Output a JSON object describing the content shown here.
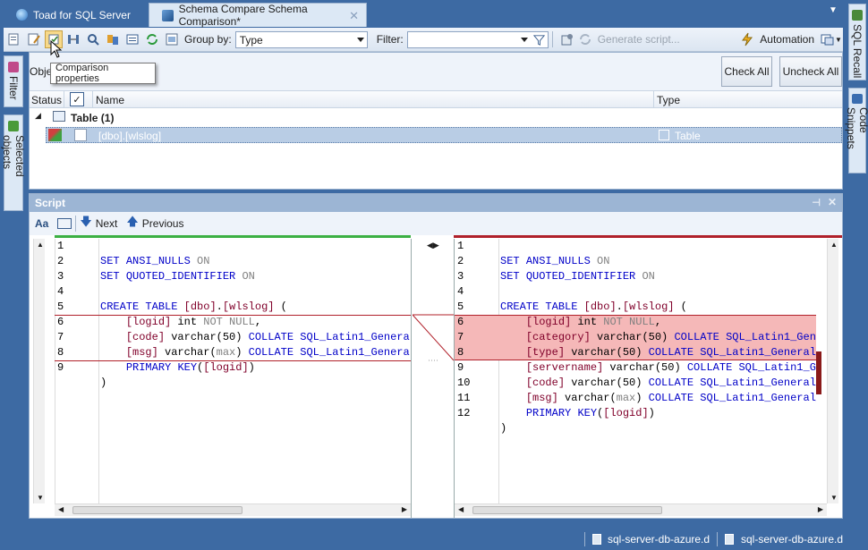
{
  "tabs": [
    {
      "label": "Toad for SQL Server",
      "icon": "toad-globe-icon"
    },
    {
      "label": "Schema Compare Schema Comparison*",
      "icon": "schema-compare-icon"
    }
  ],
  "right_dock": {
    "sql_recall": "SQL Recall",
    "code_snippets": "Code Snippets"
  },
  "left_dock": {
    "filter": "Filter",
    "selected_objects": "Selected objects"
  },
  "toolbar": {
    "group_by_label": "Group by:",
    "group_by_value": "Type",
    "filter_label": "Filter:",
    "filter_value": "",
    "generate_script": "Generate script...",
    "automation": "Automation"
  },
  "tooltip": "Comparison properties",
  "object_bar": {
    "objects_label": "Obje",
    "check_all": "Check All",
    "uncheck_all": "Uncheck All"
  },
  "grid": {
    "columns": [
      "Status",
      "Name",
      "Type"
    ],
    "group": "Table (1)",
    "rows": [
      {
        "name": "[dbo].[wlslog]",
        "type": "Table"
      }
    ]
  },
  "script": {
    "title": "Script",
    "next": "Next",
    "previous": "Previous",
    "left_lines": [
      "1",
      "2",
      "3",
      "4",
      "5",
      "6",
      "7",
      "8",
      "9"
    ],
    "right_lines": [
      "1",
      "2",
      "3",
      "4",
      "5",
      "6",
      "7",
      "8",
      "9",
      "10",
      "11",
      "12"
    ]
  },
  "status": {
    "item1": "sql-server-db-azure.d",
    "item2": "sql-server-db-azure.d"
  },
  "colors": {
    "accent": "#3d6aa3",
    "diff_highlight": "#f5b8b8",
    "left_marker": "#3cb043",
    "right_marker": "#b0202a"
  }
}
